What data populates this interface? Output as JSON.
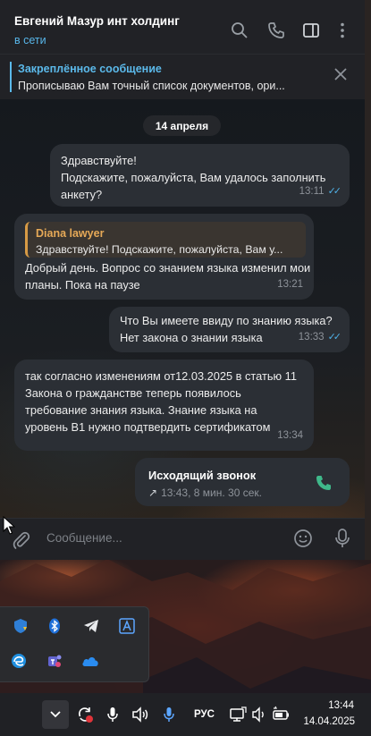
{
  "chat": {
    "title": "Евгений Мазур инт холдинг",
    "status": "в сети"
  },
  "pinned": {
    "title": "Закреплённое сообщение",
    "text": "Прописываю Вам точный список документов, ори..."
  },
  "date_label": "14 апреля",
  "messages": [
    {
      "direction": "out",
      "text": "Здравствуйте!\nПодскажите, пожалуйста, Вам удалось заполнить анкету?",
      "time": "13:11",
      "read": true
    },
    {
      "direction": "in",
      "reply_name": "Diana lawyer",
      "reply_text": "Здравствуйте! Подскажите, пожалуйста, Вам у...",
      "text": "Добрый день. Вопрос со знанием языка изменил мои планы. Пока на паузе",
      "time": "13:21"
    },
    {
      "direction": "out",
      "text": "Что Вы имеете ввиду по знанию языка?\nНет закона о знании языка",
      "time": "13:33",
      "read": true
    },
    {
      "direction": "in",
      "text": "так согласно изменениям от12.03.2025 в статью 11 Закона о гражданстве теперь появилось требование знания языка. Знание языка на уровень В1 нужно подтвердить сертификатом",
      "time": "13:34"
    }
  ],
  "call": {
    "title": "Исходящий звонок",
    "meta": "13:43, 8 мин. 30 сек."
  },
  "composer": {
    "placeholder": "Сообщение..."
  },
  "taskbar": {
    "language": "РУС",
    "time": "13:44",
    "date": "14.04.2025"
  },
  "colors": {
    "accent": "#5bb9ea",
    "reply_accent": "#e6a957",
    "call_green": "#3fb88a",
    "bubble": "#2b2f35"
  }
}
